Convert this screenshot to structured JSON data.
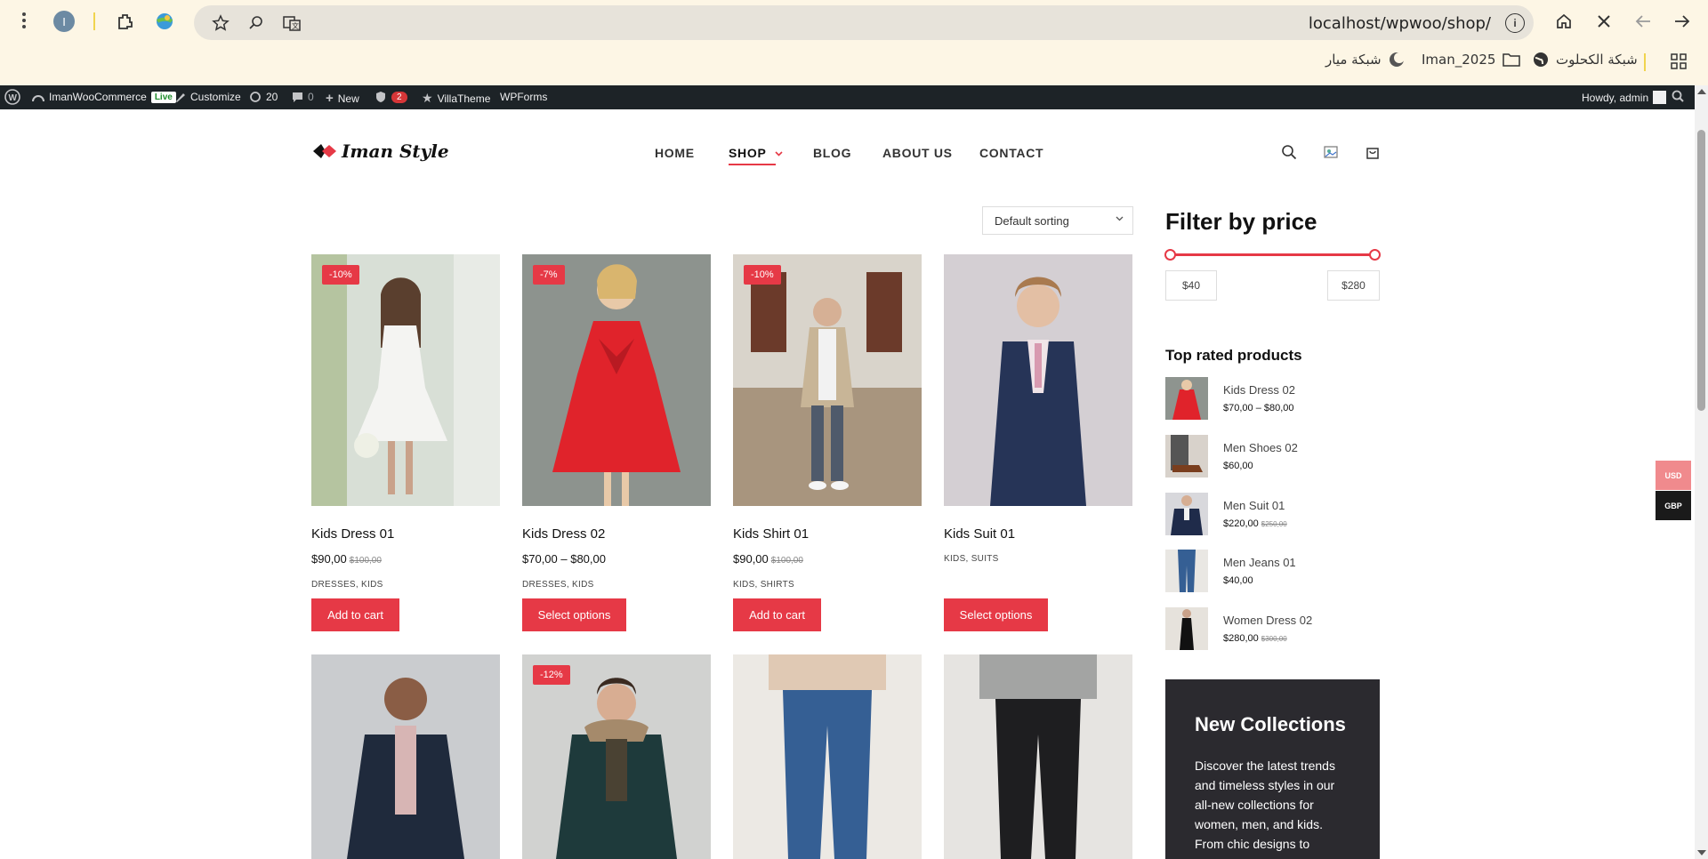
{
  "browser": {
    "url": "localhost/wpwoo/shop/",
    "profile_initial": "I",
    "bookmarks": [
      "شبكة الكحلوت",
      "Iman_2025",
      "شبكة ميار"
    ]
  },
  "admin_bar": {
    "site_name": "ImanWooCommerce",
    "live_label": "Live",
    "customize": "Customize",
    "updates_count": "20",
    "comments_count": "0",
    "new_label": "New",
    "plugin_badge": "2",
    "villatheme": "VillaTheme",
    "wpforms": "WPForms",
    "howdy": "Howdy, admin"
  },
  "site": {
    "logo": "Iman Style",
    "nav": [
      "HOME",
      "SHOP",
      "BLOG",
      "ABOUT US",
      "CONTACT"
    ],
    "active_nav": "SHOP"
  },
  "shop": {
    "sorting": "Default sorting",
    "products": [
      {
        "title": "Kids Dress 01",
        "price": "$90,00",
        "old_price": "$100,00",
        "sale": "-10%",
        "cats": "DRESSES, KIDS",
        "button": "Add to cart"
      },
      {
        "title": "Kids Dress 02",
        "price": "$70,00 – $80,00",
        "old_price": "",
        "sale": "-7%",
        "cats": "DRESSES, KIDS",
        "button": "Select options"
      },
      {
        "title": "Kids Shirt 01",
        "price": "$90,00",
        "old_price": "$100,00",
        "sale": "-10%",
        "cats": "KIDS, SHIRTS",
        "button": "Add to cart"
      },
      {
        "title": "Kids Suit 01",
        "price": "",
        "old_price": "",
        "sale": "",
        "cats": "KIDS, SUITS",
        "button": "Select options"
      },
      {
        "sale": ""
      },
      {
        "sale": "-12%"
      },
      {
        "sale": ""
      },
      {
        "sale": ""
      }
    ]
  },
  "sidebar": {
    "filter_title": "Filter by price",
    "min_price": "$40",
    "max_price": "$280",
    "top_rated_title": "Top rated products",
    "top_rated": [
      {
        "name": "Kids Dress 02",
        "price": "$70,00 – $80,00",
        "old_price": ""
      },
      {
        "name": "Men Shoes 02",
        "price": "$60,00",
        "old_price": ""
      },
      {
        "name": "Men Suit 01",
        "price": "$220,00",
        "old_price": "$250,00"
      },
      {
        "name": "Men Jeans 01",
        "price": "$40,00",
        "old_price": ""
      },
      {
        "name": "Women Dress 02",
        "price": "$280,00",
        "old_price": "$300,00"
      }
    ],
    "promo_title": "New Collections",
    "promo_text": "Discover the latest trends and timeless styles in our all-new collections for women, men, and kids. From chic designs to everyday essentials, we've"
  },
  "currency": {
    "usd": "USD",
    "gbp": "GBP"
  },
  "colors": {
    "accent": "#e63946",
    "admin_bar": "#1d2327",
    "chrome": "#fdf6e5"
  }
}
